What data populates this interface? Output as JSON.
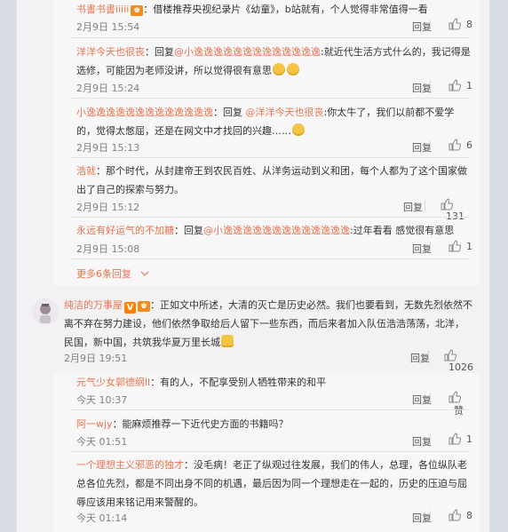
{
  "replies_group1": [
    {
      "user": "书書书書iiiii",
      "text": "：借楼推荐央视纪录片《幼童》，b站就有，个人觉得非常值得一看",
      "time": "2月9日 15:54",
      "reply_label": "回复",
      "likes": "8"
    },
    {
      "user": "洋洋今天也很丧",
      "prefix": "：回复",
      "mention": "@小逸逸逸逸逸逸逸逸逸逸逸逸逸",
      "text": ":就近代生活方式什么的，我记得是选修，可能因为老师没讲，所以觉得很有意思",
      "time": "2月9日 15:24",
      "reply_label": "回复",
      "likes": "1"
    },
    {
      "user": "小逸逸逸逸逸逸逸逸逸逸逸逸逸",
      "prefix": "：回复 ",
      "mention": "@洋洋今天也很丧",
      "text": ":你太牛了，我们以前都不爱学的，觉得太憋屈，还是在网文中才找回的兴趣……",
      "time": "2月9日 15:13",
      "reply_label": "回复",
      "likes": "6"
    },
    {
      "user": "浩就",
      "text": "：那个时代，从封建帝王到农民百姓、从洋务运动到义和团，每个人都为了这个国家做出了自己的探索与努力。",
      "time": "2月9日 15:12",
      "reply_label": "回复",
      "likes": "131"
    },
    {
      "user": "永远有好运气的不加糖",
      "prefix": "：回复",
      "mention": "@小逸逸逸逸逸逸逸逸逸逸逸逸逸",
      "text": ":过年看看 感觉很有意思",
      "time": "2月9日 15:08",
      "reply_label": "回复",
      "likes": "1"
    }
  ],
  "more_replies": "更多6条回复",
  "main_comment": {
    "user": "纯洁的万事屋",
    "vip_badge": "V",
    "text": "：正如文中所述，大清的灭亡是历史必然。我们也要看到，无数先烈依然不离不弃在努力建设，他们依然争取给后人留下一些东西，而后来者加入队伍浩浩荡荡，北洋，民国，新中国，共筑我华夏万里长城",
    "time": "2月9日 19:51",
    "reply_label": "回复",
    "likes": "1026"
  },
  "replies_group2": [
    {
      "user": "元气少女郭德纲ll",
      "text": "：有的人，不配享受别人牺牲带来的和平",
      "time": "今天 10:37",
      "reply_label": "回复",
      "likes": "赞"
    },
    {
      "user": "阿一wjy",
      "text": "：能麻烦推荐一下近代史方面的书籍吗？",
      "time": "今天 01:51",
      "reply_label": "回复",
      "likes": "1"
    },
    {
      "user": "一个理想主义邪恶的独才",
      "text": "：没毛病！老正了纵观过往发展，我们的伟人，总理，各位纵队老总各位先烈，都是不同出身不同的机遇，最后因为同一个理想走在一起的，历史的压迫与屈辱应该用来铭记用来警醒的。",
      "time": "今天 01:14",
      "reply_label": "回复",
      "likes": "8"
    }
  ],
  "icons": {
    "like": "thumbs-up-icon",
    "more": "chevron-down-icon"
  },
  "colors": {
    "username": "#eb7350",
    "background": "#f2f2f5"
  }
}
